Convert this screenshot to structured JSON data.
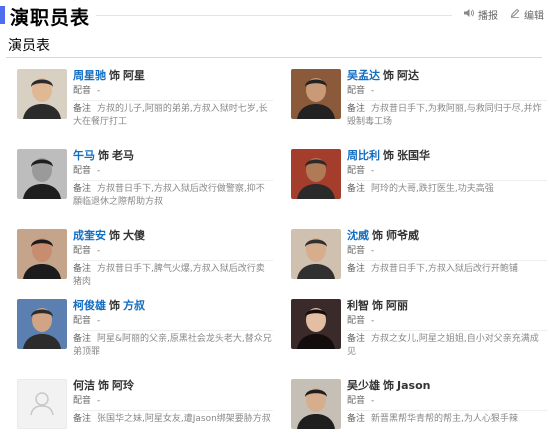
{
  "header": {
    "title": "演职员表",
    "play_label": "播报",
    "edit_label": "编辑",
    "accent_color": "#4e6ef2"
  },
  "section": {
    "title": "演员表"
  },
  "actors": [
    {
      "name": "周星驰",
      "role": "阿星",
      "name_link": true,
      "role_link": false,
      "dub_label": "配音",
      "dub_value": "-",
      "note_label": "备注",
      "note": "方叔的儿子,阿丽的弟弟,方叔入狱时七岁,长大在餐厅打工",
      "photo": "portrait-1"
    },
    {
      "name": "吴孟达",
      "role": "阿达",
      "name_link": true,
      "role_link": false,
      "dub_label": "配音",
      "dub_value": "-",
      "note_label": "备注",
      "note": "方叔昔日手下,为救阿丽,与救同归于尽,并炸毁制毒工场",
      "photo": "portrait-2"
    },
    {
      "name": "午马",
      "role": "老马",
      "name_link": true,
      "role_link": false,
      "dub_label": "配音",
      "dub_value": "-",
      "note_label": "备注",
      "note": "方叔昔日手下,方叔入狱后改行做警察,抑不願临退休之際帮助方叔",
      "photo": "portrait-3"
    },
    {
      "name": "周比利",
      "role": "张国华",
      "name_link": true,
      "role_link": false,
      "dub_label": "配音",
      "dub_value": "-",
      "note_label": "备注",
      "note": "阿玲的大哥,跌打医生,功夫高强",
      "photo": "portrait-4"
    },
    {
      "name": "成奎安",
      "role": "大傻",
      "name_link": true,
      "role_link": false,
      "dub_label": "配音",
      "dub_value": "-",
      "note_label": "备注",
      "note": "方叔昔日手下,脾气火爆,方叔入狱后改行卖猪肉",
      "photo": "portrait-5"
    },
    {
      "name": "沈威",
      "role": "师爷威",
      "name_link": true,
      "role_link": false,
      "dub_label": "配音",
      "dub_value": "-",
      "note_label": "备注",
      "note": "方叔昔日手下,方叔入狱后改行开鲍铺",
      "photo": "portrait-6"
    },
    {
      "name": "柯俊雄",
      "role": "方叔",
      "name_link": true,
      "role_link": true,
      "dub_label": "配音",
      "dub_value": "-",
      "note_label": "备注",
      "note": "阿星&阿丽的父亲,原黑社会龙头老大,替众兄弟顶罪",
      "photo": "portrait-7"
    },
    {
      "name": "利智",
      "role": "阿丽",
      "name_link": false,
      "role_link": false,
      "dub_label": "配音",
      "dub_value": "-",
      "note_label": "备注",
      "note": "方叔之女儿,阿星之姐姐,自小对父亲充满成见",
      "photo": "portrait-8"
    },
    {
      "name": "何洁",
      "role": "阿玲",
      "name_link": false,
      "role_link": false,
      "dub_label": "配音",
      "dub_value": "-",
      "note_label": "备注",
      "note": "张国华之妹,阿星女友,遭Jason绑架要胁方叔",
      "photo": "placeholder"
    },
    {
      "name": "吴少雄",
      "role": "Jason",
      "name_link": false,
      "role_link": false,
      "dub_label": "配音",
      "dub_value": "-",
      "note_label": "备注",
      "note": "新晋黑帮华青帮的帮主,为人心狠手辣",
      "photo": "portrait-10"
    }
  ]
}
